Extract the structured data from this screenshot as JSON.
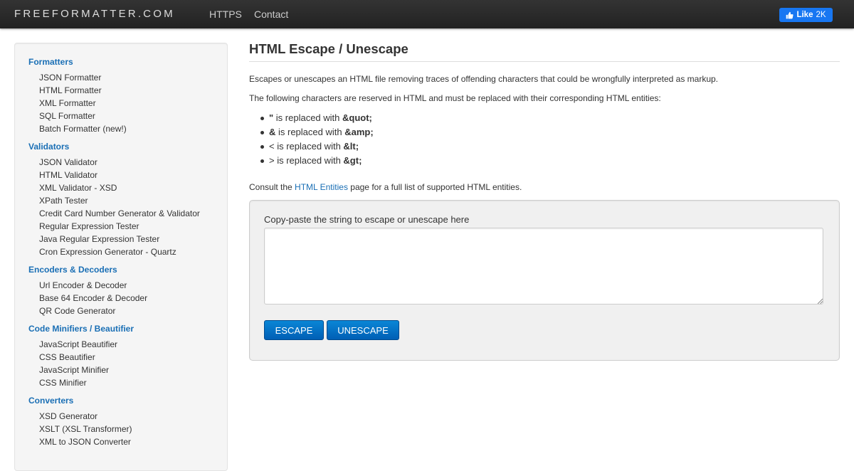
{
  "header": {
    "brand": "FREEFORMATTER.COM",
    "nav": [
      "HTTPS",
      "Contact"
    ],
    "fb_like": {
      "label": "Like",
      "count": "2K",
      "color": "#1877f2"
    }
  },
  "sidebar": {
    "sections": [
      {
        "title": "Formatters",
        "items": [
          "JSON Formatter",
          "HTML Formatter",
          "XML Formatter",
          "SQL Formatter",
          "Batch Formatter (new!)"
        ]
      },
      {
        "title": "Validators",
        "items": [
          "JSON Validator",
          "HTML Validator",
          "XML Validator - XSD",
          "XPath Tester",
          "Credit Card Number Generator & Validator",
          "Regular Expression Tester",
          "Java Regular Expression Tester",
          "Cron Expression Generator - Quartz"
        ]
      },
      {
        "title": "Encoders & Decoders",
        "items": [
          "Url Encoder & Decoder",
          "Base 64 Encoder & Decoder",
          "QR Code Generator"
        ]
      },
      {
        "title": "Code Minifiers / Beautifier",
        "items": [
          "JavaScript Beautifier",
          "CSS Beautifier",
          "JavaScript Minifier",
          "CSS Minifier"
        ]
      },
      {
        "title": "Converters",
        "items": [
          "XSD Generator",
          "XSLT (XSL Transformer)",
          "XML to JSON Converter"
        ]
      }
    ]
  },
  "main": {
    "title": "HTML Escape / Unescape",
    "intro": "Escapes or unescapes an HTML file removing traces of offending characters that could be wrongfully interpreted as markup.",
    "reserved": "The following characters are reserved in HTML and must be replaced with their corresponding HTML entities:",
    "replacements": [
      {
        "char": "\"",
        "text": " is replaced with ",
        "entity": "&quot;"
      },
      {
        "char": "&",
        "text": " is replaced with ",
        "entity": "&amp;"
      },
      {
        "char": "<",
        "text": " is replaced with ",
        "entity": "&lt;"
      },
      {
        "char": ">",
        "text": " is replaced with ",
        "entity": "&gt;"
      }
    ],
    "consult_before": "Consult the ",
    "consult_link": "HTML Entities",
    "consult_after": " page for a full list of supported HTML entities.",
    "form": {
      "label": "Copy-paste the string to escape or unescape here",
      "value": "",
      "escape_label": "ESCAPE",
      "unescape_label": "UNESCAPE"
    }
  },
  "colors": {
    "link": "#1a6fb5",
    "button": "#0a6fc7",
    "topbar": "#2b2b2b"
  }
}
